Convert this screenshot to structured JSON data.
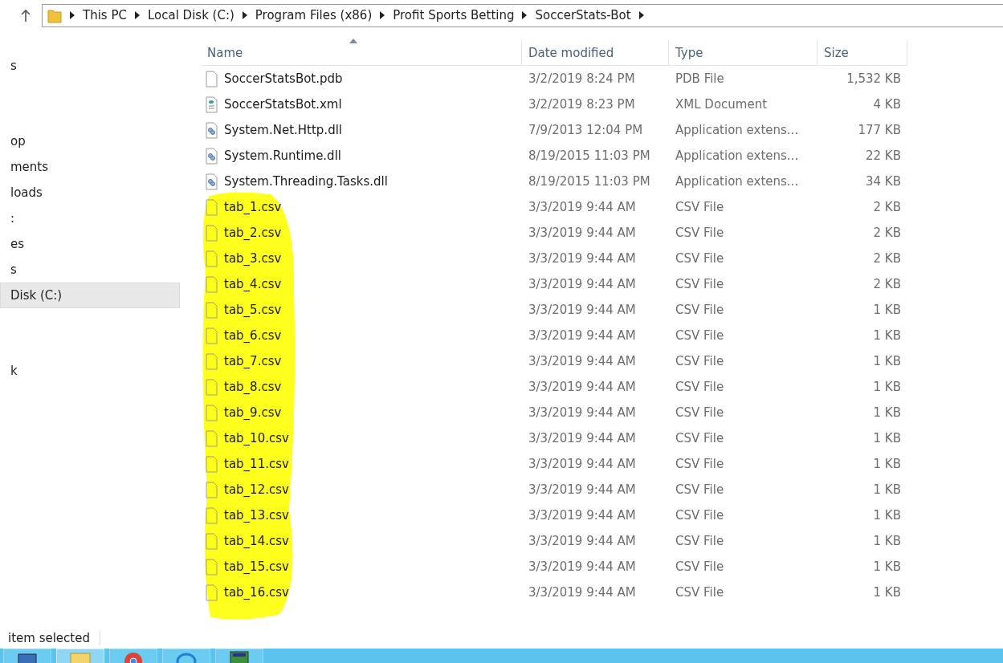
{
  "address_bar": {
    "crumbs": [
      "This PC",
      "Local Disk (C:)",
      "Program Files (x86)",
      "Profit Sports Betting",
      "SoccerStats-Bot"
    ]
  },
  "sidebar": {
    "groups": [
      {
        "items": [
          {
            "label": "s",
            "selected": false
          }
        ]
      },
      {
        "items": [
          {
            "label": "op",
            "selected": false
          },
          {
            "label": "ments",
            "selected": false
          },
          {
            "label": "loads",
            "selected": false
          },
          {
            "label": ":",
            "selected": false
          },
          {
            "label": "es",
            "selected": false
          },
          {
            "label": "s",
            "selected": false
          },
          {
            "label": "Disk (C:)",
            "selected": true
          }
        ]
      },
      {
        "items": [
          {
            "label": "k",
            "selected": false
          }
        ]
      }
    ]
  },
  "file_list": {
    "columns": [
      "Name",
      "Date modified",
      "Type",
      "Size"
    ],
    "rows": [
      {
        "name": "SoccerStatsBot.pdb",
        "date": "3/2/2019 8:24 PM",
        "type": "PDB File",
        "size": "1,532 KB",
        "kind": "file"
      },
      {
        "name": "SoccerStatsBot.xml",
        "date": "3/2/2019 8:23 PM",
        "type": "XML Document",
        "size": "4 KB",
        "kind": "xml"
      },
      {
        "name": "System.Net.Http.dll",
        "date": "7/9/2013 12:04 PM",
        "type": "Application extens...",
        "size": "177 KB",
        "kind": "dll"
      },
      {
        "name": "System.Runtime.dll",
        "date": "8/19/2015 11:03 PM",
        "type": "Application extens...",
        "size": "22 KB",
        "kind": "dll"
      },
      {
        "name": "System.Threading.Tasks.dll",
        "date": "8/19/2015 11:03 PM",
        "type": "Application extens...",
        "size": "34 KB",
        "kind": "dll"
      },
      {
        "name": "tab_1.csv",
        "date": "3/3/2019 9:44 AM",
        "type": "CSV File",
        "size": "2 KB",
        "kind": "file"
      },
      {
        "name": "tab_2.csv",
        "date": "3/3/2019 9:44 AM",
        "type": "CSV File",
        "size": "2 KB",
        "kind": "file"
      },
      {
        "name": "tab_3.csv",
        "date": "3/3/2019 9:44 AM",
        "type": "CSV File",
        "size": "2 KB",
        "kind": "file"
      },
      {
        "name": "tab_4.csv",
        "date": "3/3/2019 9:44 AM",
        "type": "CSV File",
        "size": "2 KB",
        "kind": "file"
      },
      {
        "name": "tab_5.csv",
        "date": "3/3/2019 9:44 AM",
        "type": "CSV File",
        "size": "1 KB",
        "kind": "file"
      },
      {
        "name": "tab_6.csv",
        "date": "3/3/2019 9:44 AM",
        "type": "CSV File",
        "size": "1 KB",
        "kind": "file"
      },
      {
        "name": "tab_7.csv",
        "date": "3/3/2019 9:44 AM",
        "type": "CSV File",
        "size": "1 KB",
        "kind": "file"
      },
      {
        "name": "tab_8.csv",
        "date": "3/3/2019 9:44 AM",
        "type": "CSV File",
        "size": "1 KB",
        "kind": "file"
      },
      {
        "name": "tab_9.csv",
        "date": "3/3/2019 9:44 AM",
        "type": "CSV File",
        "size": "1 KB",
        "kind": "file"
      },
      {
        "name": "tab_10.csv",
        "date": "3/3/2019 9:44 AM",
        "type": "CSV File",
        "size": "1 KB",
        "kind": "file"
      },
      {
        "name": "tab_11.csv",
        "date": "3/3/2019 9:44 AM",
        "type": "CSV File",
        "size": "1 KB",
        "kind": "file"
      },
      {
        "name": "tab_12.csv",
        "date": "3/3/2019 9:44 AM",
        "type": "CSV File",
        "size": "1 KB",
        "kind": "file"
      },
      {
        "name": "tab_13.csv",
        "date": "3/3/2019 9:44 AM",
        "type": "CSV File",
        "size": "1 KB",
        "kind": "file"
      },
      {
        "name": "tab_14.csv",
        "date": "3/3/2019 9:44 AM",
        "type": "CSV File",
        "size": "1 KB",
        "kind": "file"
      },
      {
        "name": "tab_15.csv",
        "date": "3/3/2019 9:44 AM",
        "type": "CSV File",
        "size": "1 KB",
        "kind": "file"
      },
      {
        "name": "tab_16.csv",
        "date": "3/3/2019 9:44 AM",
        "type": "CSV File",
        "size": "1 KB",
        "kind": "file"
      }
    ]
  },
  "status_bar": {
    "text": "item selected"
  },
  "taskbar": {
    "apps": [
      {
        "kind": "start",
        "active": false
      },
      {
        "kind": "folder",
        "active": true
      },
      {
        "kind": "browser",
        "active": false
      },
      {
        "kind": "globe",
        "active": false
      },
      {
        "kind": "app",
        "active": false
      }
    ]
  }
}
